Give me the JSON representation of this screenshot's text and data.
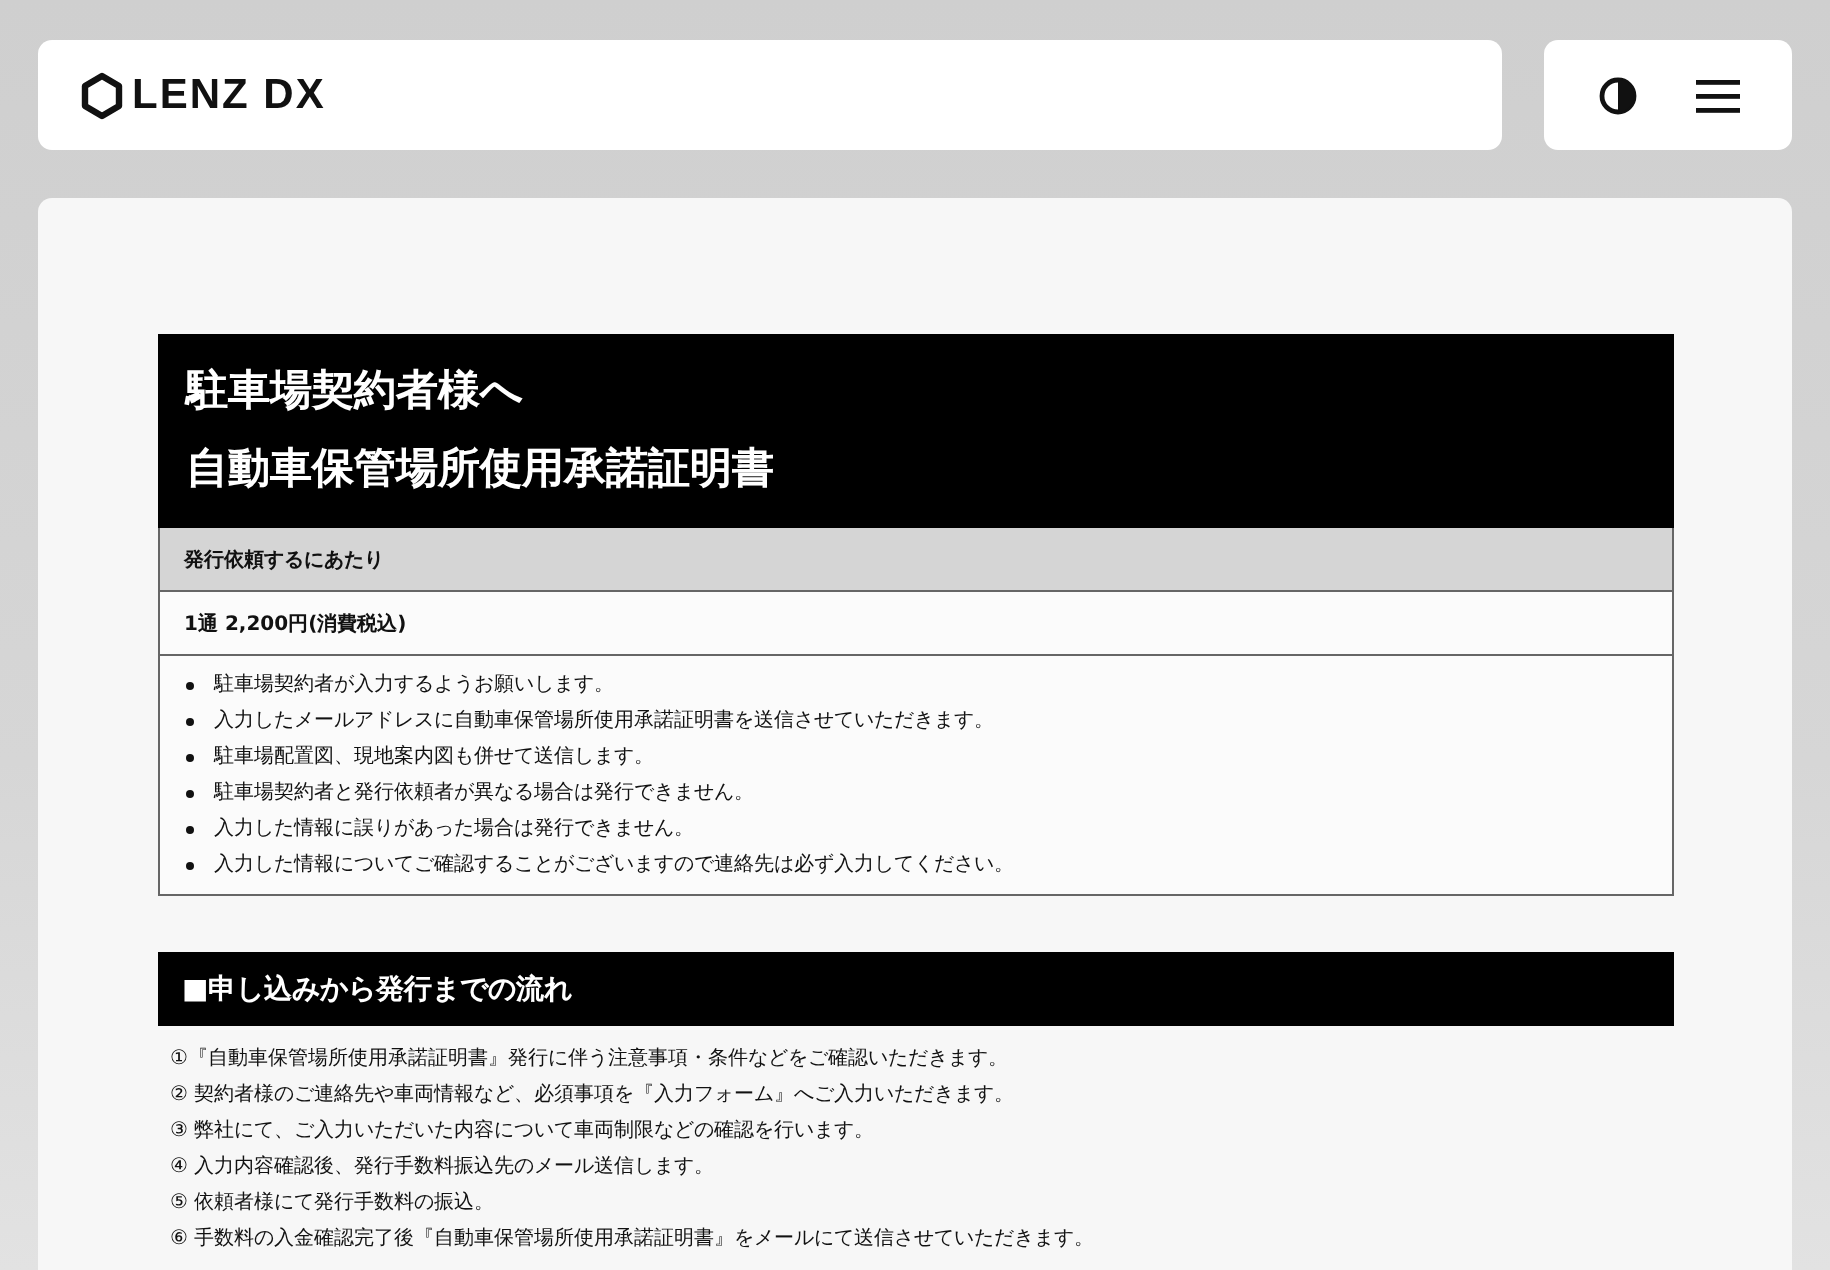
{
  "header": {
    "logo_text": "LENZ DX"
  },
  "notice": {
    "title_lines": [
      "駐車場契約者様へ",
      "自動車保管場所使用承諾証明書"
    ],
    "subheading": "発行依頼するにあたり",
    "price": "1通 2,200円(消費税込)",
    "bullets": [
      "駐車場契約者が入力するようお願いします。",
      "入力したメールアドレスに自動車保管場所使用承諾証明書を送信させていただきます。",
      "駐車場配置図、現地案内図も併せて送信します。",
      "駐車場契約者と発行依頼者が異なる場合は発行できません。",
      "入力した情報に誤りがあった場合は発行できません。",
      "入力した情報についてご確認することがございますので連絡先は必ず入力してください。"
    ]
  },
  "flow": {
    "heading": "■申し込みから発行までの流れ",
    "steps": [
      "①『自動車保管場所使用承諾証明書』発行に伴う注意事項・条件などをご確認いただきます。",
      "② 契約者様のご連絡先や車両情報など、必須事項を『入力フォーム』へご入力いただきます。",
      "③ 弊社にて、ご入力いただいた内容について車両制限などの確認を行います。",
      "④ 入力内容確認後、発行手数料振込先のメール送信します。",
      "⑤ 依頼者様にて発行手数料の振込。",
      "⑥ 手数料の入金確認完了後『自動車保管場所使用承諾証明書』をメールにて送信させていただきます。"
    ]
  }
}
